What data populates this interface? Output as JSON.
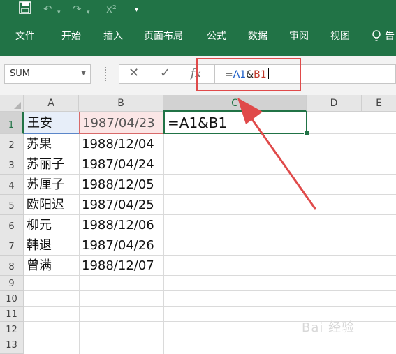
{
  "quick_access": {
    "save_icon": "save-icon",
    "undo_icon": "undo-icon",
    "redo_icon": "redo-icon",
    "superscript_label": "x²",
    "customize_icon": "customize-quick-access-icon"
  },
  "ribbon": {
    "tabs": [
      {
        "label": "文件"
      },
      {
        "label": "开始"
      },
      {
        "label": "插入"
      },
      {
        "label": "页面布局"
      },
      {
        "label": "公式"
      },
      {
        "label": "数据"
      },
      {
        "label": "审阅"
      },
      {
        "label": "视图"
      },
      {
        "label": "告"
      }
    ],
    "tell_me_icon": "lightbulb-icon"
  },
  "formula_bar": {
    "name_box": "SUM",
    "cancel_symbol": "✕",
    "enter_symbol": "✓",
    "fx_symbol": "fx",
    "formula_prefix": "=",
    "formula_ref1": "A1",
    "formula_op": "&",
    "formula_ref2": "B1",
    "highlight_color": "#e04a4a"
  },
  "sheet": {
    "columns": [
      "A",
      "B",
      "C",
      "D",
      "E"
    ],
    "rows": [
      "1",
      "2",
      "3",
      "4",
      "5",
      "6",
      "7",
      "8",
      "9",
      "10",
      "11",
      "12",
      "13"
    ],
    "col_a": [
      "王安",
      "苏果",
      "苏丽子",
      "苏厘子",
      "欧阳迟",
      "柳元",
      "韩退",
      "曾满"
    ],
    "col_b": [
      "1987/04/23",
      "1988/12/04",
      "1987/04/24",
      "1988/12/05",
      "1987/04/25",
      "1988/12/06",
      "1987/04/26",
      "1988/12/07"
    ],
    "c1": "=A1&B1",
    "active_cell": "C1"
  },
  "colors": {
    "brand_green": "#217346",
    "ref_blue": "#1e5fc8",
    "ref_red": "#c0392b",
    "annotation_red": "#e04a4a"
  },
  "watermark": "Bai 经验"
}
